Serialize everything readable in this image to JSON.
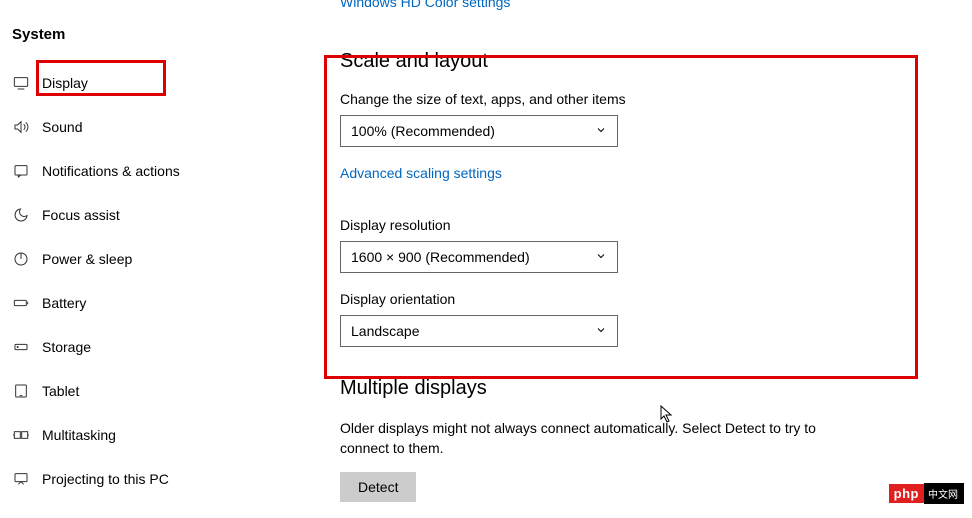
{
  "sidebar": {
    "title": "System",
    "items": [
      {
        "label": "Display"
      },
      {
        "label": "Sound"
      },
      {
        "label": "Notifications & actions"
      },
      {
        "label": "Focus assist"
      },
      {
        "label": "Power & sleep"
      },
      {
        "label": "Battery"
      },
      {
        "label": "Storage"
      },
      {
        "label": "Tablet"
      },
      {
        "label": "Multitasking"
      },
      {
        "label": "Projecting to this PC"
      }
    ]
  },
  "top": {
    "link": "Windows HD Color settings"
  },
  "scale": {
    "heading": "Scale and layout",
    "size_label": "Change the size of text, apps, and other items",
    "size_value": "100% (Recommended)",
    "advanced_link": "Advanced scaling settings",
    "resolution_label": "Display resolution",
    "resolution_value": "1600 × 900 (Recommended)",
    "orientation_label": "Display orientation",
    "orientation_value": "Landscape"
  },
  "multi": {
    "heading": "Multiple displays",
    "desc": "Older displays might not always connect automatically. Select Detect to try to connect to them.",
    "detect": "Detect"
  },
  "watermark": {
    "red": "php",
    "black": "中文网"
  }
}
